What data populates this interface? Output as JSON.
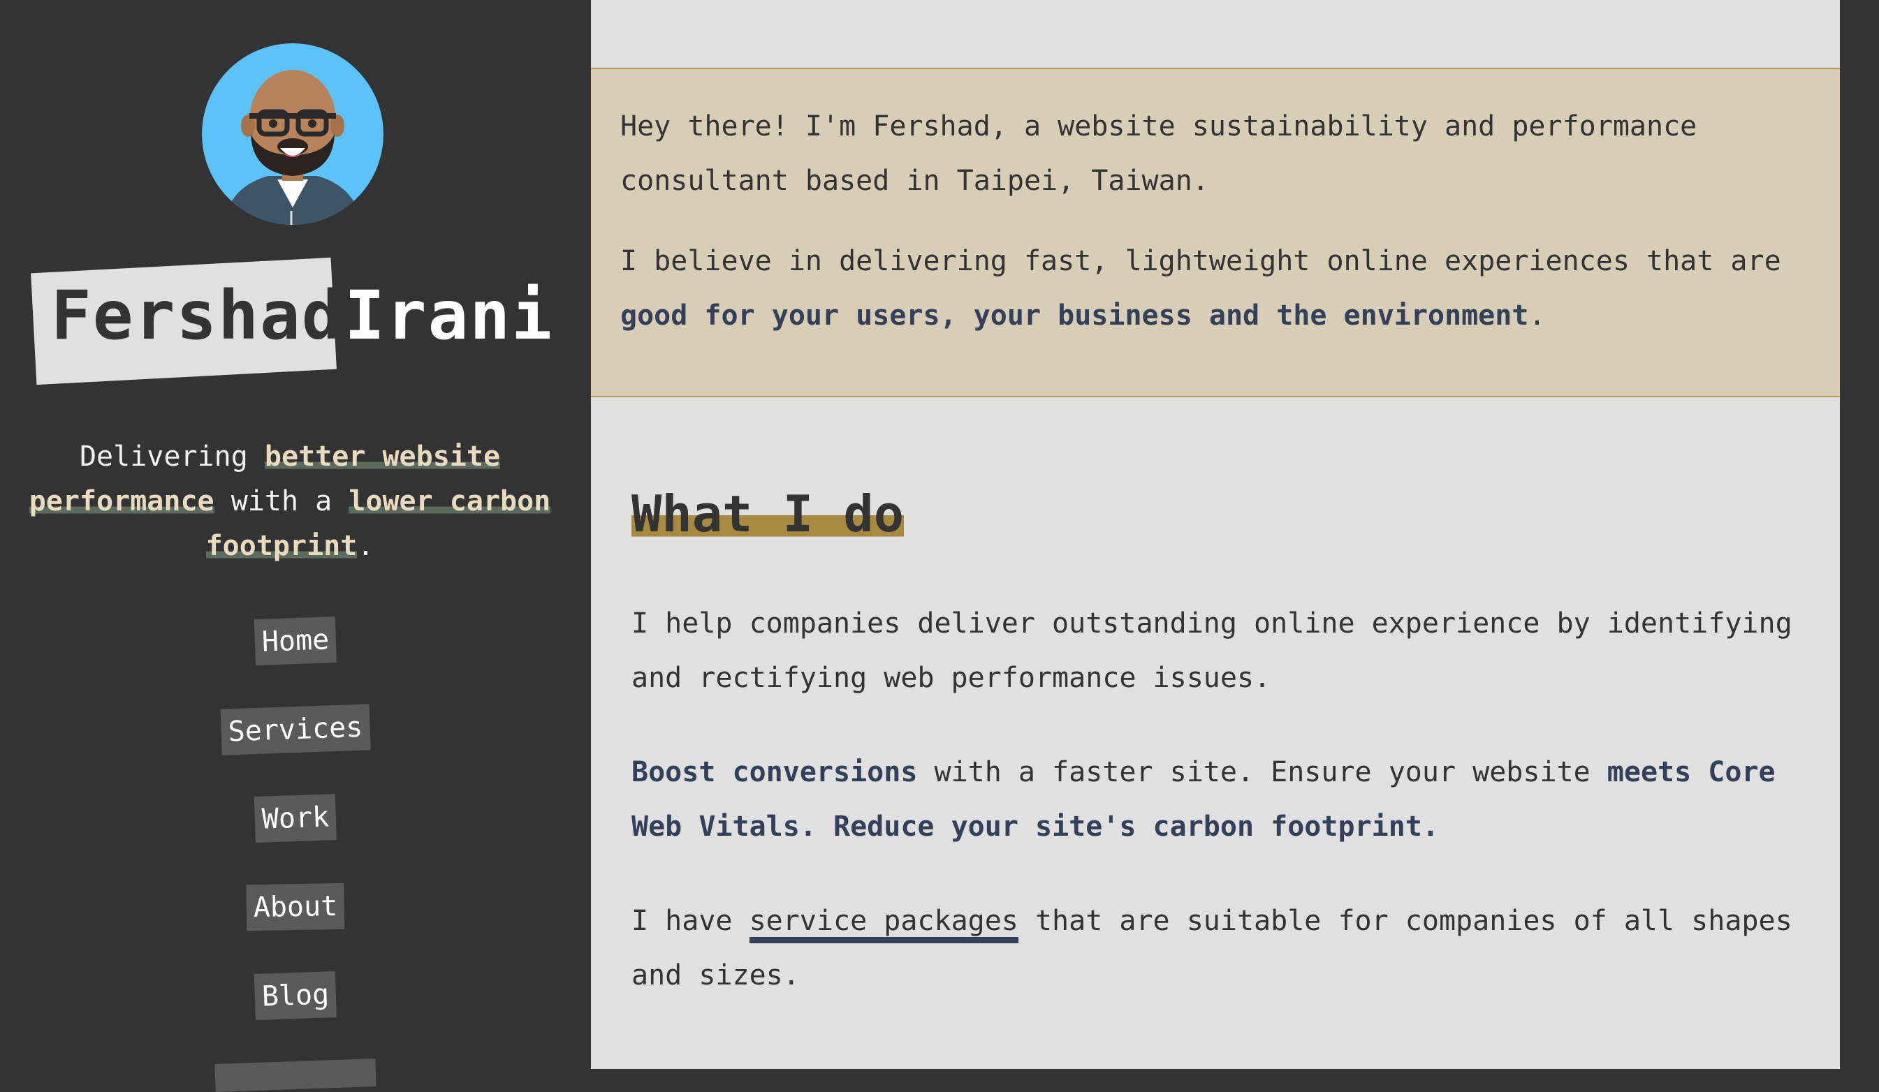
{
  "sidebar": {
    "name_first": "Fershad",
    "name_last": "Irani",
    "tagline": {
      "t1": "Delivering ",
      "h1": "better website performance",
      "t2": " with a ",
      "h2": "lower carbon footprint",
      "t3": "."
    },
    "nav": [
      "Home",
      "Services",
      "Work",
      "About",
      "Blog"
    ]
  },
  "intro": {
    "p1": "Hey there! I'm Fershad, a website sustainability and performance consultant based in Taipei, Taiwan.",
    "p2_text": "I believe in delivering fast, lightweight online experiences that are ",
    "p2_strong": "good for your users, your business and the environment",
    "p2_end": "."
  },
  "section": {
    "heading": "What I do",
    "p1": "I help companies deliver outstanding online experience by identifying and rectifying web performance issues.",
    "p2": {
      "s1": "Boost conversions",
      "t1": " with a faster site. Ensure your website ",
      "s2": "meets Core Web Vitals",
      "t2": ". ",
      "s3": "Reduce your site's carbon footprint",
      "t3": "."
    },
    "p3": {
      "t1": "I have ",
      "link": "service packages",
      "t2": " that are suitable for companies of all shapes and sizes."
    }
  },
  "colors": {
    "sidebar_bg": "#333333",
    "main_bg": "#e0e0e0",
    "intro_bg": "#d8ceb7",
    "accent_gold": "#a88940",
    "link_navy": "#34405a"
  }
}
